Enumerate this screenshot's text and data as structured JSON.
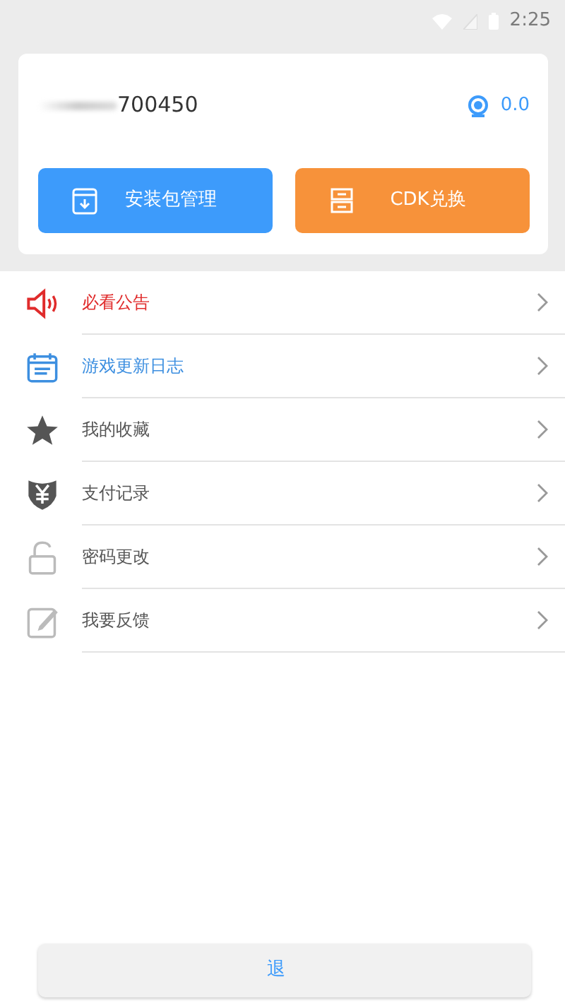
{
  "status_bar": {
    "time": "2:25"
  },
  "account": {
    "username": "700450",
    "balance": "0.0"
  },
  "actions": [
    {
      "label": "安装包管理",
      "kind": "package"
    },
    {
      "label": "CDK兑换",
      "kind": "cdk"
    }
  ],
  "menu": [
    {
      "label": "必看公告",
      "kind": "notice",
      "color": "#e02b2b"
    },
    {
      "label": "游戏更新日志",
      "kind": "calendar",
      "color": "#3d8fe0"
    },
    {
      "label": "我的收藏",
      "kind": "star",
      "color": "#555555"
    },
    {
      "label": "支付记录",
      "kind": "pay",
      "color": "#555555"
    },
    {
      "label": "密码更改",
      "kind": "lock",
      "color": "#555555"
    },
    {
      "label": "我要反馈",
      "kind": "edit",
      "color": "#555555"
    }
  ],
  "logout": {
    "label": "退"
  }
}
